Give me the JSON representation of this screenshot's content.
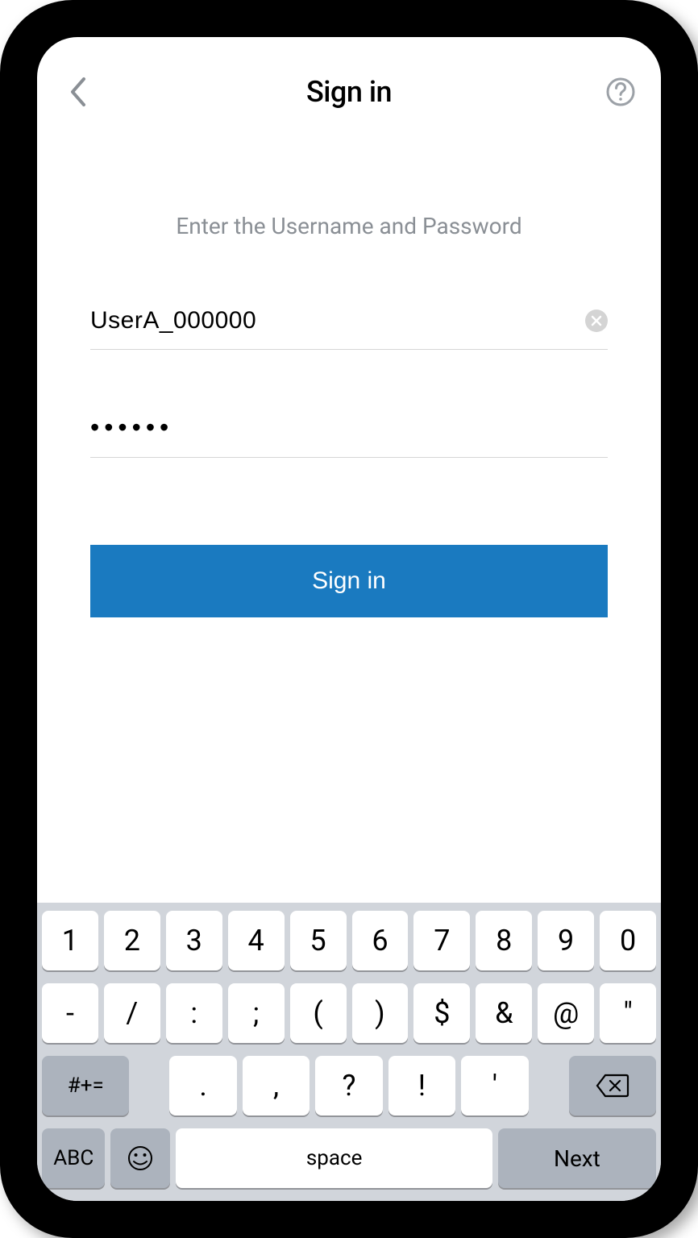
{
  "header": {
    "title": "Sign in"
  },
  "instruction": "Enter the Username and Password",
  "form": {
    "username_value": "UserA_000000",
    "password_value": "••••••",
    "signin_label": "Sign in"
  },
  "keyboard": {
    "row1": [
      "1",
      "2",
      "3",
      "4",
      "5",
      "6",
      "7",
      "8",
      "9",
      "0"
    ],
    "row2": [
      "-",
      "/",
      ":",
      ";",
      "(",
      ")",
      "$",
      "&",
      "@",
      "\""
    ],
    "row3_symbols": "#+=",
    "row3": [
      ".",
      ",",
      "?",
      "!",
      "'"
    ],
    "abc_label": "ABC",
    "space_label": "space",
    "next_label": "Next"
  }
}
